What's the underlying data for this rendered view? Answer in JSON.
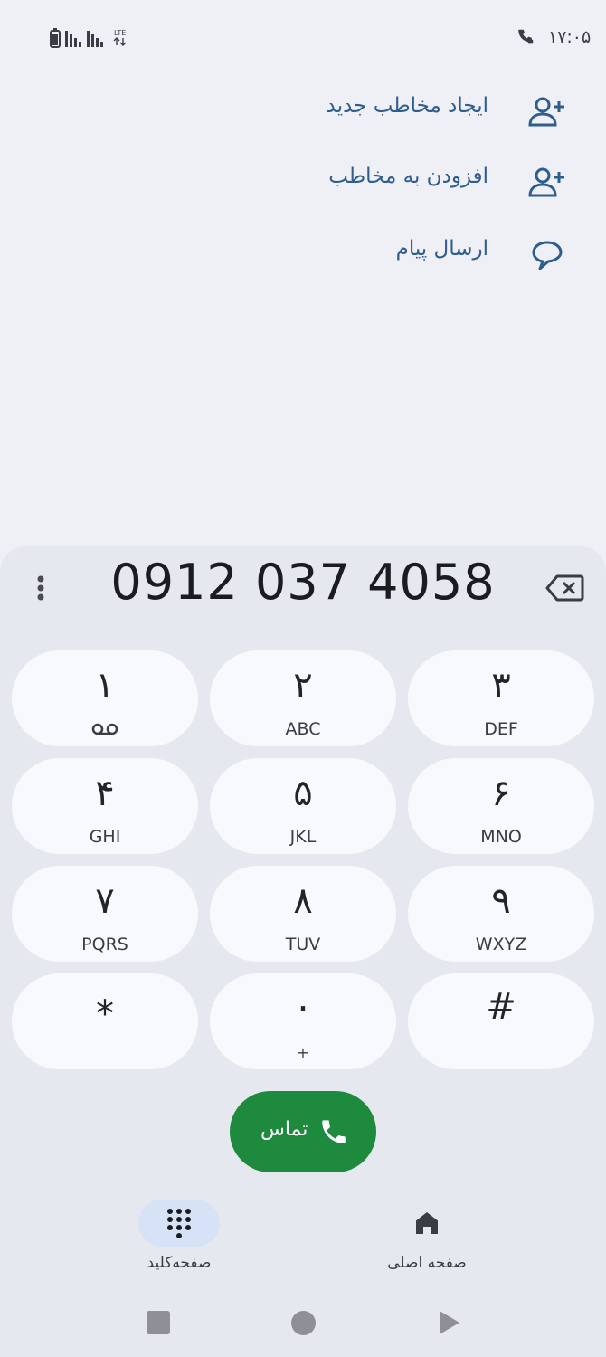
{
  "status_bar": {
    "time": "۱۷:۰۵",
    "network": "LTE"
  },
  "actions": [
    {
      "label": "ایجاد مخاطب جدید",
      "icon": "person-add-icon"
    },
    {
      "label": "افزودن به مخاطب",
      "icon": "person-add-icon"
    },
    {
      "label": "ارسال پیام",
      "icon": "message-icon"
    }
  ],
  "dialer": {
    "number": "0912 037 4058",
    "keys": [
      {
        "digit": "۱",
        "letters": "",
        "voicemail": true
      },
      {
        "digit": "۲",
        "letters": "ABC"
      },
      {
        "digit": "۳",
        "letters": "DEF"
      },
      {
        "digit": "۴",
        "letters": "GHI"
      },
      {
        "digit": "۵",
        "letters": "JKL"
      },
      {
        "digit": "۶",
        "letters": "MNO"
      },
      {
        "digit": "۷",
        "letters": "PQRS"
      },
      {
        "digit": "۸",
        "letters": "TUV"
      },
      {
        "digit": "۹",
        "letters": "WXYZ"
      },
      {
        "digit": "*",
        "letters": ""
      },
      {
        "digit": "۰",
        "letters": "+"
      },
      {
        "digit": "#",
        "letters": ""
      }
    ],
    "call_label": "تماس"
  },
  "bottom_nav": {
    "keypad_label": "صفحه‌کلید",
    "home_label": "صفحه اصلی"
  },
  "colors": {
    "accent": "#2f5d8d",
    "call_green": "#1d8a3d",
    "sheet": "#e5e8ef",
    "background": "#eef0f6"
  }
}
